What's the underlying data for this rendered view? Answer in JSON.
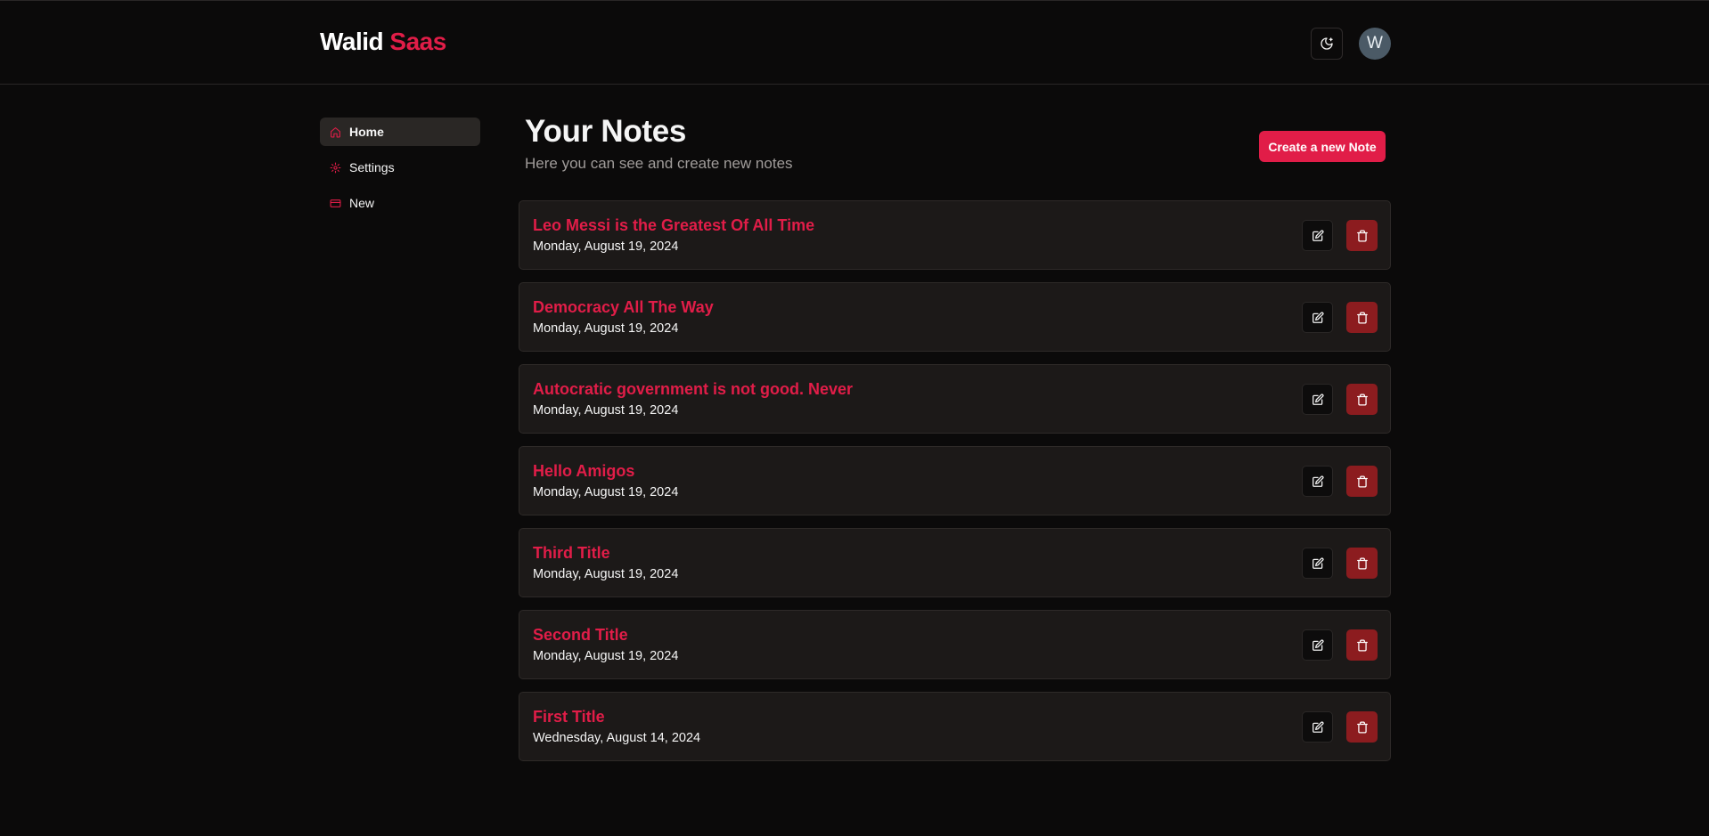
{
  "header": {
    "brand_primary": "Walid",
    "brand_accent": "Saas",
    "theme_toggle_icon": "moon-icon",
    "avatar_initial": "W"
  },
  "sidebar": {
    "items": [
      {
        "label": "Home",
        "icon": "home-icon",
        "active": true
      },
      {
        "label": "Settings",
        "icon": "gear-icon",
        "active": false
      },
      {
        "label": "New",
        "icon": "credit-card-icon",
        "active": false
      }
    ]
  },
  "main": {
    "title": "Your Notes",
    "subtitle": "Here you can see and create new notes",
    "create_button": "Create a new Note"
  },
  "notes": [
    {
      "title": "Leo Messi is the Greatest Of All Time",
      "date": "Monday, August 19, 2024"
    },
    {
      "title": "Democracy All The Way",
      "date": "Monday, August 19, 2024"
    },
    {
      "title": "Autocratic government is not good. Never",
      "date": "Monday, August 19, 2024"
    },
    {
      "title": "Hello Amigos",
      "date": "Monday, August 19, 2024"
    },
    {
      "title": "Third Title",
      "date": "Monday, August 19, 2024"
    },
    {
      "title": "Second Title",
      "date": "Monday, August 19, 2024"
    },
    {
      "title": "First Title",
      "date": "Wednesday, August 14, 2024"
    }
  ],
  "colors": {
    "accent": "#e11d48",
    "background": "#0b0a0a",
    "card": "#1c1918",
    "delete": "#8c1c1f"
  }
}
